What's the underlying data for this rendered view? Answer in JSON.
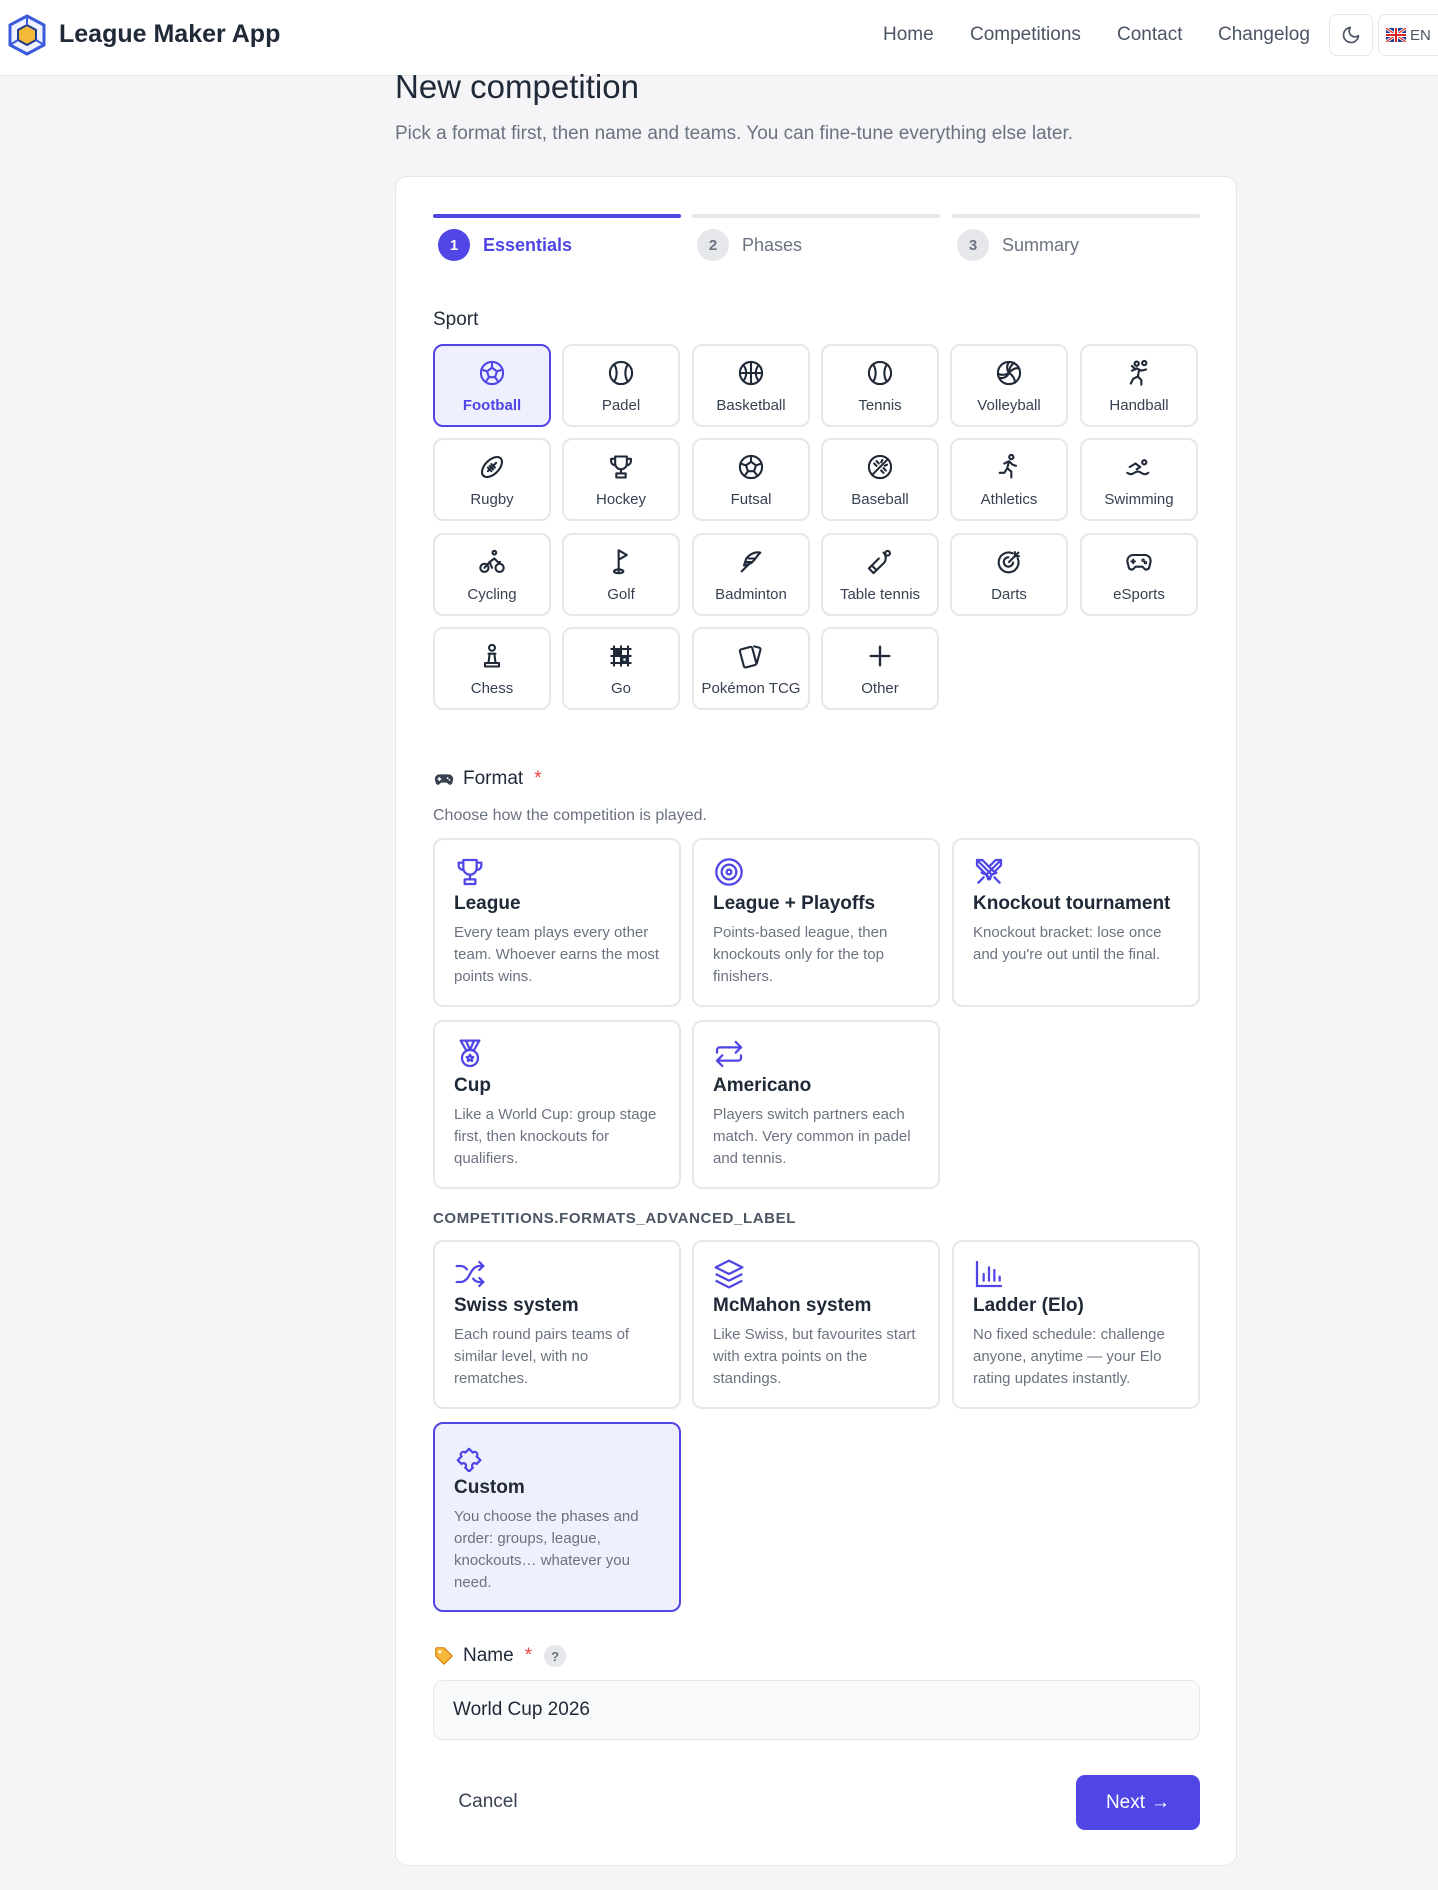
{
  "header": {
    "brand": "League Maker App",
    "nav": [
      "Home",
      "Competitions",
      "Contact",
      "Changelog"
    ],
    "lang": "EN",
    "theme_icon": "moon-icon"
  },
  "page": {
    "title": "New competition",
    "subtitle": "Pick a format first, then name and teams. You can fine-tune everything else later."
  },
  "steps": [
    {
      "num": "1",
      "label": "Essentials",
      "active": true
    },
    {
      "num": "2",
      "label": "Phases",
      "active": false
    },
    {
      "num": "3",
      "label": "Summary",
      "active": false
    }
  ],
  "sport": {
    "label": "Sport",
    "selected": "Football",
    "items": [
      {
        "label": "Football",
        "icon": "football-icon"
      },
      {
        "label": "Padel",
        "icon": "ball-icon"
      },
      {
        "label": "Basketball",
        "icon": "basketball-icon"
      },
      {
        "label": "Tennis",
        "icon": "ball-icon"
      },
      {
        "label": "Volleyball",
        "icon": "volleyball-icon"
      },
      {
        "label": "Handball",
        "icon": "handball-icon"
      },
      {
        "label": "Rugby",
        "icon": "rugby-ball-icon"
      },
      {
        "label": "Hockey",
        "icon": "trophy-icon"
      },
      {
        "label": "Futsal",
        "icon": "football-icon"
      },
      {
        "label": "Baseball",
        "icon": "baseball-icon"
      },
      {
        "label": "Athletics",
        "icon": "runner-icon"
      },
      {
        "label": "Swimming",
        "icon": "swimmer-icon"
      },
      {
        "label": "Cycling",
        "icon": "bike-icon"
      },
      {
        "label": "Golf",
        "icon": "golf-flag-icon"
      },
      {
        "label": "Badminton",
        "icon": "feather-icon"
      },
      {
        "label": "Table tennis",
        "icon": "paddle-icon"
      },
      {
        "label": "Darts",
        "icon": "target-icon"
      },
      {
        "label": "eSports",
        "icon": "gamepad-icon"
      },
      {
        "label": "Chess",
        "icon": "chess-pawn-icon"
      },
      {
        "label": "Go",
        "icon": "grid-icon"
      },
      {
        "label": "Pokémon TCG",
        "icon": "cards-icon"
      },
      {
        "label": "Other",
        "icon": "plus-icon"
      }
    ]
  },
  "format": {
    "label": "Format",
    "required": "*",
    "hint": "Choose how the competition is played.",
    "advanced_label": "COMPETITIONS.FORMATS_ADVANCED_LABEL",
    "selected": "Custom",
    "items": [
      {
        "title": "League",
        "desc": "Every team plays every other team. Whoever earns the most points wins.",
        "icon": "trophy-icon"
      },
      {
        "title": "League + Playoffs",
        "desc": "Points-based league, then knockouts only for the top finishers.",
        "icon": "target-icon"
      },
      {
        "title": "Knockout tournament",
        "desc": "Knockout bracket: lose once and you're out until the final.",
        "icon": "swords-icon"
      },
      {
        "title": "Cup",
        "desc": "Like a World Cup: group stage first, then knockouts for qualifiers.",
        "icon": "medal-icon"
      },
      {
        "title": "Americano",
        "desc": "Players switch partners each match. Very common in padel and tennis.",
        "icon": "swap-arrows-icon"
      }
    ],
    "advanced": [
      {
        "title": "Swiss system",
        "desc": "Each round pairs teams of similar level, with no rematches.",
        "icon": "shuffle-icon"
      },
      {
        "title": "McMahon system",
        "desc": "Like Swiss, but favourites start with extra points on the standings.",
        "icon": "layers-icon"
      },
      {
        "title": "Ladder (Elo)",
        "desc": "No fixed schedule: challenge anyone, anytime — your Elo rating updates instantly.",
        "icon": "bar-chart-icon"
      },
      {
        "title": "Custom",
        "desc": "You choose the phases and order: groups, league, knockouts… whatever you need.",
        "icon": "puzzle-icon"
      }
    ]
  },
  "name": {
    "label": "Name",
    "required": "*",
    "help": "?",
    "value": "World Cup 2026"
  },
  "actions": {
    "cancel": "Cancel",
    "next": "Next",
    "next_arrow": "→"
  },
  "colors": {
    "accent": "#4f46e5",
    "selected_bg": "#eef0fe",
    "required": "#ef4444"
  }
}
